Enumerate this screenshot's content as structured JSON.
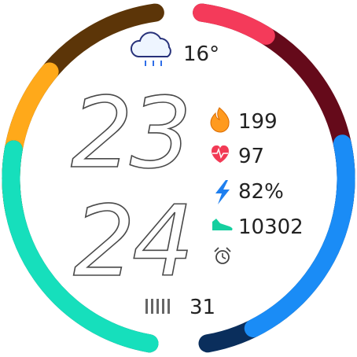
{
  "watch_face": {
    "time": {
      "hours": "23",
      "minutes": "24"
    },
    "weather": {
      "icon": "rain-cloud-icon",
      "temperature": "16°"
    },
    "stats": {
      "calories": {
        "icon": "flame-icon",
        "value": "199"
      },
      "heart_rate": {
        "icon": "heart-pulse-icon",
        "value": "97"
      },
      "battery": {
        "icon": "lightning-bolt-icon",
        "value": "82%"
      },
      "steps": {
        "icon": "shoe-icon",
        "value": "10302"
      },
      "alarm": {
        "icon": "alarm-clock-icon"
      }
    },
    "date": {
      "icon": "calendar-bars-icon",
      "value": "31"
    },
    "arcs": [
      {
        "name": "arc-top-left",
        "fill": 0.55,
        "track_color": "#5c3508",
        "fill_color": "#ffa91a"
      },
      {
        "name": "arc-top-right",
        "fill": 0.25,
        "track_color": "#650a1a",
        "fill_color": "#f43a5a"
      },
      {
        "name": "arc-bottom-left",
        "fill": 1.0,
        "track_color": "#054f43",
        "fill_color": "#16dfbc"
      },
      {
        "name": "arc-bottom-right",
        "fill": 0.82,
        "track_color": "#0a2e5c",
        "fill_color": "#1a8cf6"
      }
    ]
  }
}
